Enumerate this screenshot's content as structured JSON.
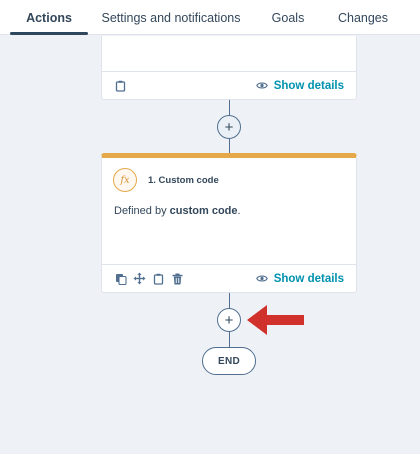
{
  "tabs": [
    {
      "label": "Actions",
      "active": true
    },
    {
      "label": "Settings and notifications",
      "active": false
    },
    {
      "label": "Goals",
      "active": false
    },
    {
      "label": "Changes",
      "active": false
    }
  ],
  "top_card": {
    "show_details_label": "Show details"
  },
  "action_card": {
    "badge": "fx",
    "title": "1. Custom code",
    "desc_prefix": "Defined by ",
    "desc_bold": "custom code",
    "desc_suffix": ".",
    "show_details_label": "Show details"
  },
  "connectors": {
    "plus_symbol": "+"
  },
  "end_node": {
    "label": "END"
  },
  "colors": {
    "accent": "#e5a94a",
    "link": "#0091ae",
    "arrow": "#d0312d",
    "text": "#33475b",
    "background": "#eef2f7"
  }
}
